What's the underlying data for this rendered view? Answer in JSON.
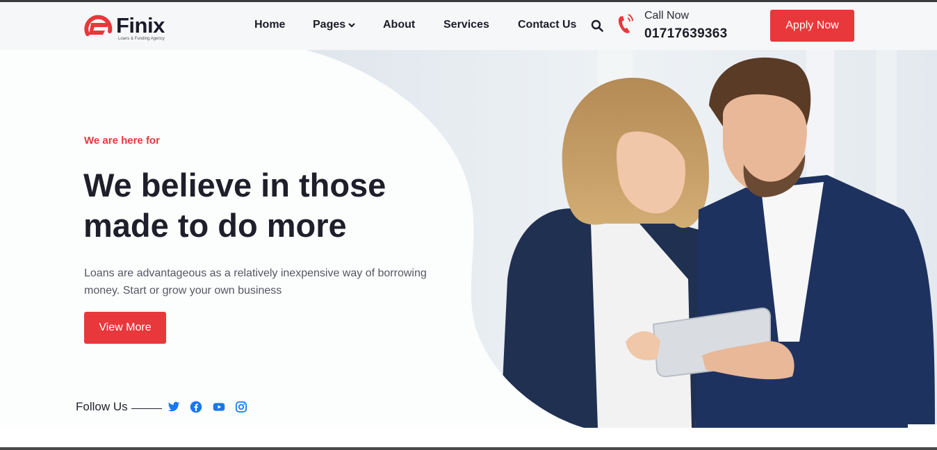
{
  "brand": {
    "name": "Finix",
    "tagline": "Loans & Funding Agency",
    "accent": "#e8383b"
  },
  "nav": {
    "items": [
      {
        "label": "Home"
      },
      {
        "label": "Pages"
      },
      {
        "label": "About"
      },
      {
        "label": "Services"
      },
      {
        "label": "Contact Us"
      }
    ],
    "search_icon": "search-icon"
  },
  "contact": {
    "label": "Call Now",
    "phone": "01717639363",
    "icon": "phone-icon"
  },
  "header": {
    "apply_label": "Apply Now"
  },
  "hero": {
    "tagline": "We are here for",
    "headline": "We believe in those made to do more",
    "description": "Loans are advantageous as a relatively inexpensive way of borrowing money. Start or grow your own business",
    "cta_label": "View More",
    "image": "business-people-with-tablet"
  },
  "follow": {
    "label": "Follow Us",
    "icons": [
      "twitter-icon",
      "facebook-icon",
      "youtube-icon",
      "instagram-icon"
    ],
    "icon_color": "#1877f2"
  }
}
